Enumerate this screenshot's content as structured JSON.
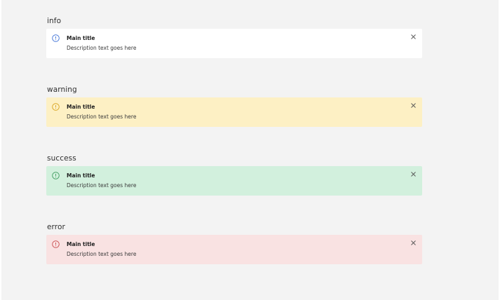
{
  "alerts": [
    {
      "section_label": "info",
      "title": "Main title",
      "description": "Description text goes here",
      "icon": "info-circle-icon",
      "background": "#ffffff",
      "icon_color": "#3b6fd6"
    },
    {
      "section_label": "warning",
      "title": "Main title",
      "description": "Description text goes here",
      "icon": "warning-circle-icon",
      "background": "#fdf0c4",
      "icon_color": "#d8a21a"
    },
    {
      "section_label": "success",
      "title": "Main title",
      "description": "Description text goes here",
      "icon": "success-circle-icon",
      "background": "#d2f0dd",
      "icon_color": "#3c9a5c"
    },
    {
      "section_label": "error",
      "title": "Main title",
      "description": "Description text goes here",
      "icon": "error-circle-icon",
      "background": "#f9e2e2",
      "icon_color": "#c8484b"
    }
  ],
  "close_icon": "close-icon"
}
